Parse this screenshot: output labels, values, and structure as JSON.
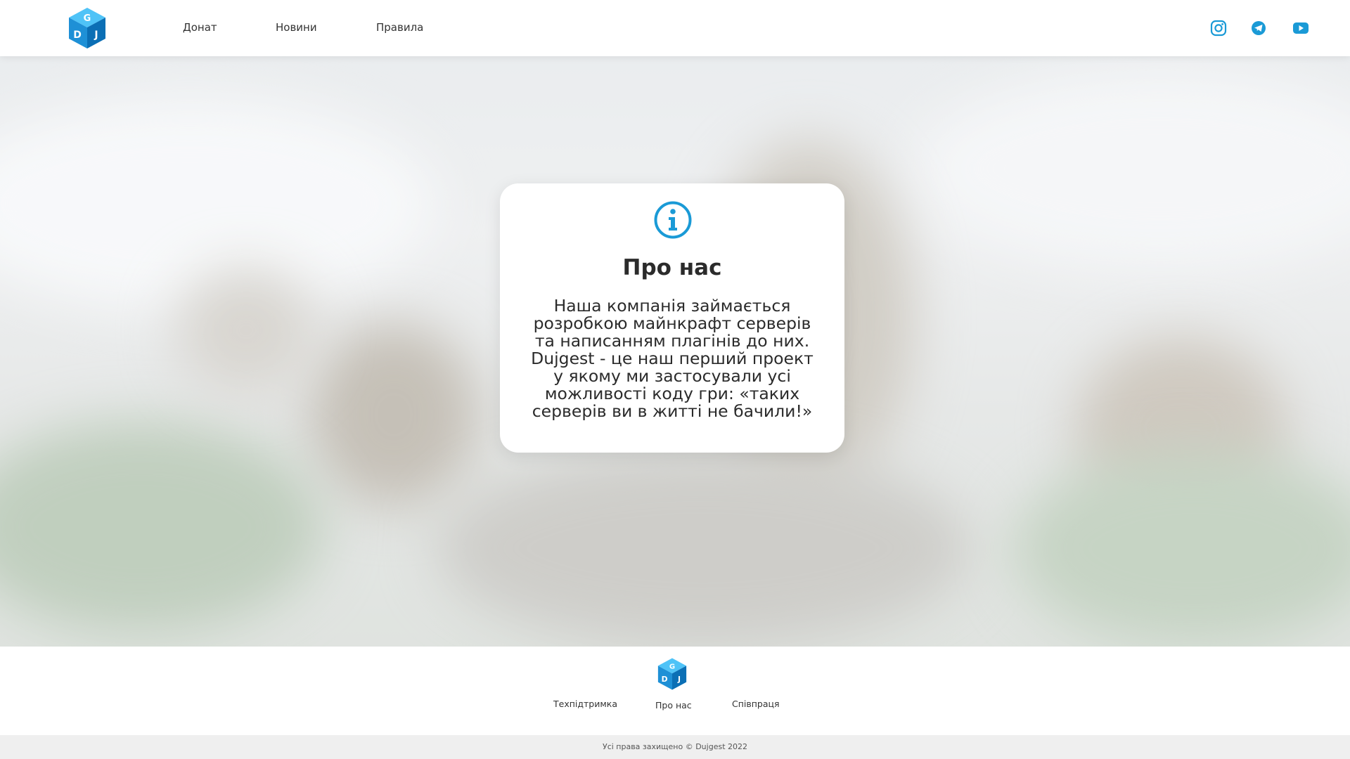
{
  "header": {
    "logo": {
      "icon": "dujgest-cube-logo",
      "letters": [
        "G",
        "D",
        "J"
      ]
    },
    "nav": [
      {
        "label": "Донат"
      },
      {
        "label": "Новини"
      },
      {
        "label": "Правила"
      }
    ],
    "social": [
      {
        "icon": "instagram-icon"
      },
      {
        "icon": "telegram-icon"
      },
      {
        "icon": "youtube-icon"
      }
    ]
  },
  "card": {
    "icon": "info-icon",
    "title": "Про нас",
    "text": "Наша компанія займається розробкою майнкрафт серверів та написанням плагінів до них. Dujgest - це наш перший проект у якому ми застосували усі можливості коду гри: «таких серверів ви в житті не бачили!»"
  },
  "footer": {
    "logo": {
      "icon": "dujgest-cube-logo",
      "letters": [
        "G",
        "D",
        "J"
      ]
    },
    "links": [
      {
        "label": "Техпідтримка"
      },
      {
        "label": "Про нас"
      },
      {
        "label": "Співпраця"
      }
    ],
    "copyright": "Усі права захищено © Dujgest 2022"
  },
  "colors": {
    "accent": "#1a9ad6",
    "text": "#2b2b2b",
    "copyright_bar": "#efefef"
  }
}
